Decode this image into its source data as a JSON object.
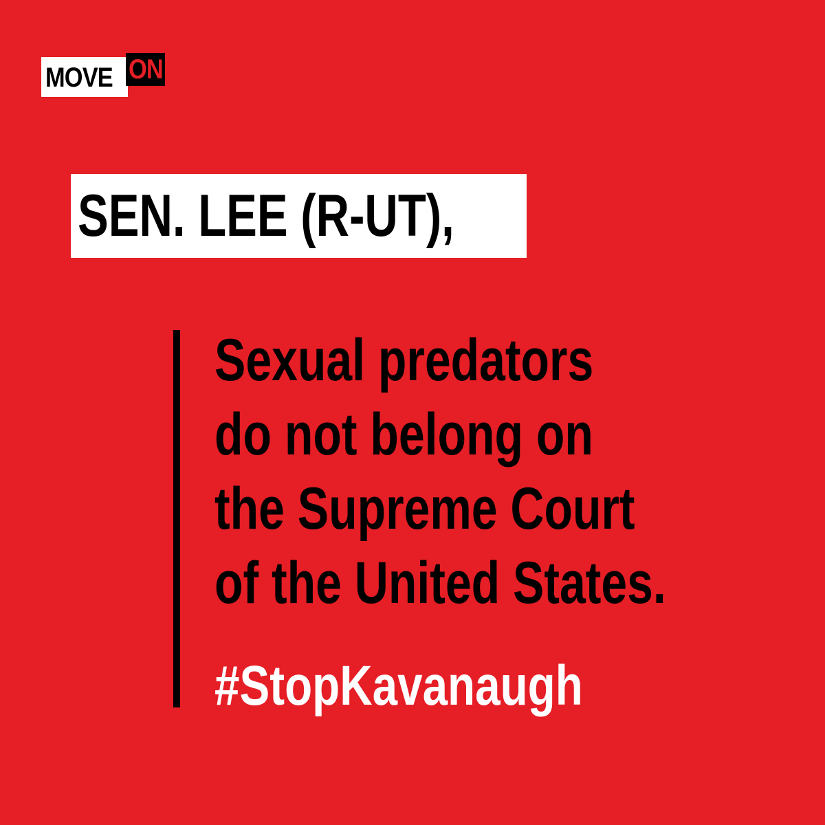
{
  "background_color": "#e61e25",
  "logo": {
    "move_text": "MOVE",
    "on_text": "ON",
    "on_color": "#e61e25"
  },
  "addressee": "SEN. LEE (R-UT),",
  "quote": {
    "lines": [
      "Sexual predators",
      "do not belong on",
      "the Supreme Court",
      "of the United States."
    ]
  },
  "hashtag": {
    "text": "#StopKavanaugh",
    "color": "#ffffff"
  }
}
